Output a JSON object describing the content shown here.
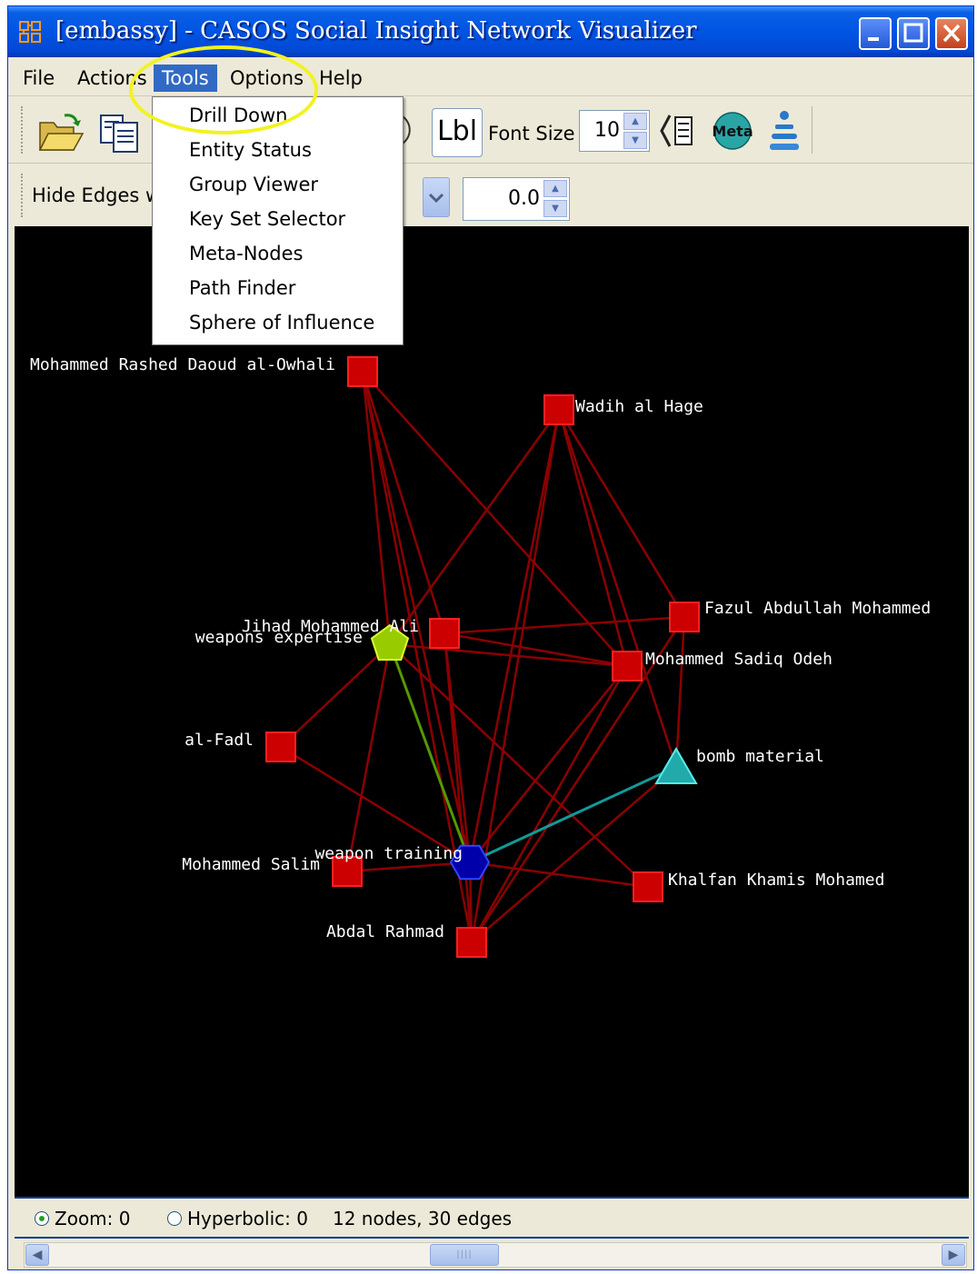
{
  "window": {
    "title": "[embassy] - CASOS Social Insight Network Visualizer"
  },
  "menubar": {
    "items": [
      "File",
      "Actions",
      "Tools",
      "Options",
      "Help"
    ],
    "active": "Tools"
  },
  "tools_menu": {
    "items": [
      "Drill Down",
      "Entity Status",
      "Group Viewer",
      "Key Set Selector",
      "Meta-Nodes",
      "Path Finder",
      "Sphere of Influence"
    ]
  },
  "toolbar": {
    "lbl_label": "Lbl",
    "font_size_label": "Font Size",
    "font_size_value": "10",
    "meta_label": "Meta"
  },
  "toolbar2": {
    "hide_edges_label": "Hide Edges w",
    "threshold_value": "0.0"
  },
  "status": {
    "zoom_label": "Zoom: 0",
    "hyperbolic_label": "Hyperbolic: 0",
    "summary": "12 nodes, 30 edges"
  },
  "colors": {
    "agent_node": "#cc0000",
    "knowledge_node": "#99cc00",
    "task_node": "#0000aa",
    "resource_node": "#22aaaa",
    "edge_default": "#8b0000",
    "edge_green": "#559900",
    "edge_teal": "#119999"
  },
  "graph": {
    "nodes": [
      {
        "id": "owhali",
        "label": "Mohammed Rashed Daoud al-Owhali",
        "shape": "square",
        "color": "agent_node"
      },
      {
        "id": "hage",
        "label": "Wadih al Hage",
        "shape": "square",
        "color": "agent_node"
      },
      {
        "id": "jihad",
        "label": "Jihad Mohammed Ali",
        "shape": "square",
        "color": "agent_node"
      },
      {
        "id": "fazul",
        "label": "Fazul Abdullah Mohammed",
        "shape": "square",
        "color": "agent_node"
      },
      {
        "id": "odeh",
        "label": "Mohammed Sadiq Odeh",
        "shape": "square",
        "color": "agent_node"
      },
      {
        "id": "weapons_expertise",
        "label": "weapons expertise",
        "shape": "pentagon",
        "color": "knowledge_node"
      },
      {
        "id": "fadl",
        "label": "al-Fadl",
        "shape": "square",
        "color": "agent_node"
      },
      {
        "id": "bomb",
        "label": "bomb material",
        "shape": "triangle",
        "color": "resource_node"
      },
      {
        "id": "salim",
        "label": "Mohammed Salim",
        "shape": "square",
        "color": "agent_node"
      },
      {
        "id": "weapon_training",
        "label": "weapon training",
        "shape": "hexagon",
        "color": "task_node"
      },
      {
        "id": "khalfan",
        "label": "Khalfan Khamis Mohamed",
        "shape": "square",
        "color": "agent_node"
      },
      {
        "id": "rahmad",
        "label": "Abdal Rahmad",
        "shape": "square",
        "color": "agent_node"
      }
    ],
    "edges": [
      [
        "owhali",
        "jihad"
      ],
      [
        "owhali",
        "weapons_expertise"
      ],
      [
        "owhali",
        "weapon_training"
      ],
      [
        "owhali",
        "rahmad"
      ],
      [
        "owhali",
        "odeh"
      ],
      [
        "hage",
        "weapons_expertise"
      ],
      [
        "hage",
        "weapon_training"
      ],
      [
        "hage",
        "fazul"
      ],
      [
        "hage",
        "odeh"
      ],
      [
        "hage",
        "bomb"
      ],
      [
        "hage",
        "rahmad"
      ],
      [
        "jihad",
        "fazul"
      ],
      [
        "jihad",
        "odeh"
      ],
      [
        "jihad",
        "weapon_training"
      ],
      [
        "jihad",
        "rahmad"
      ],
      [
        "weapons_expertise",
        "odeh"
      ],
      [
        "weapons_expertise",
        "fadl"
      ],
      [
        "weapons_expertise",
        "salim"
      ],
      [
        "weapons_expertise",
        "khalfan"
      ],
      [
        "fazul",
        "bomb"
      ],
      [
        "fazul",
        "rahmad"
      ],
      [
        "odeh",
        "weapon_training"
      ],
      [
        "odeh",
        "rahmad"
      ],
      [
        "fadl",
        "weapon_training"
      ],
      [
        "salim",
        "weapon_training"
      ],
      [
        "weapon_training",
        "khalfan"
      ],
      [
        "weapon_training",
        "rahmad"
      ],
      [
        "bomb",
        "rahmad"
      ],
      [
        "weapons_expertise",
        "weapon_training",
        "edge_green"
      ],
      [
        "weapon_training",
        "bomb",
        "edge_teal"
      ]
    ]
  }
}
